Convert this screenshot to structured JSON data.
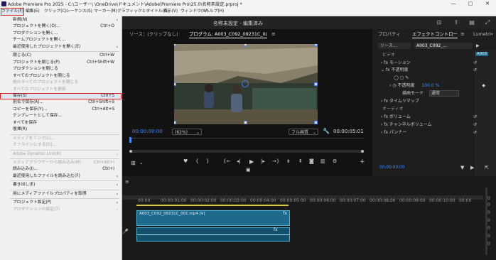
{
  "window": {
    "title": "Adobe Premiere Pro 2025 - C:\\ユーザー\\        \\OneDrive\\ドキュメント\\Adobe\\Premiere Pro\\25.0\\名称未設定.prproj *",
    "minimize": "—",
    "maximize": "▢",
    "close": "✕"
  },
  "menubar": [
    "ファイル(F)",
    "編集(E)",
    "クリップ(C)",
    "シーケンス(S)",
    "マーカー(M)",
    "グラフィックとタイトル(G)",
    "表示(V)",
    "ウィンドウ(W)",
    "ヘルプ(H)"
  ],
  "project_title": "名称未設定 - 編集済み",
  "file_menu": [
    {
      "label": "新規(N)",
      "shortcut": "",
      "submenu": true,
      "disabled": false
    },
    {
      "label": "プロジェクトを開く(O)...",
      "shortcut": "Ctrl+O",
      "submenu": false,
      "disabled": false
    },
    {
      "label": "プロダクションを開く...",
      "shortcut": "",
      "submenu": false,
      "disabled": false
    },
    {
      "label": "チームプロジェクトを開く...",
      "shortcut": "",
      "submenu": false,
      "disabled": false
    },
    {
      "label": "最近使用したプロジェクトを開く(E)",
      "shortcut": "",
      "submenu": true,
      "disabled": false
    },
    {
      "sep": true
    },
    {
      "label": "閉じる(C)",
      "shortcut": "Ctrl+W",
      "submenu": false,
      "disabled": false
    },
    {
      "label": "プロジェクトを閉じる(P)",
      "shortcut": "Ctrl+Shift+W",
      "submenu": false,
      "disabled": false
    },
    {
      "label": "プロダクションを閉じる",
      "shortcut": "",
      "submenu": false,
      "disabled": false
    },
    {
      "label": "すべてのプロジェクトを閉じる",
      "shortcut": "",
      "submenu": false,
      "disabled": false
    },
    {
      "label": "他のすべてのプロジェクトを閉じる",
      "shortcut": "",
      "submenu": false,
      "disabled": true
    },
    {
      "label": "すべてのプロジェクトを更新",
      "shortcut": "",
      "submenu": false,
      "disabled": true
    },
    {
      "label": "保存(S)",
      "shortcut": "Ctrl+S",
      "submenu": false,
      "disabled": false,
      "highlight": true
    },
    {
      "label": "別名で保存(A)...",
      "shortcut": "Ctrl+Shift+S",
      "submenu": false,
      "disabled": false
    },
    {
      "label": "コピーを保存(Y)...",
      "shortcut": "Ctrl+Alt+S",
      "submenu": false,
      "disabled": false
    },
    {
      "label": "テンプレートとして保存...",
      "shortcut": "",
      "submenu": false,
      "disabled": false
    },
    {
      "label": "すべてを保存",
      "shortcut": "",
      "submenu": false,
      "disabled": false
    },
    {
      "label": "復帰(R)",
      "shortcut": "",
      "submenu": false,
      "disabled": false
    },
    {
      "sep": true
    },
    {
      "label": "メディアをリンク(L)...",
      "shortcut": "",
      "submenu": false,
      "disabled": true
    },
    {
      "label": "オフラインにする(O)...",
      "shortcut": "",
      "submenu": false,
      "disabled": true
    },
    {
      "sep": true
    },
    {
      "label": "Adobe Dynamic Link(K)",
      "shortcut": "",
      "submenu": true,
      "disabled": true
    },
    {
      "sep": true
    },
    {
      "label": "メディアブラウザーから読み込み(M)",
      "shortcut": "Ctrl+Alt+I",
      "submenu": false,
      "disabled": true
    },
    {
      "label": "読み込み(I)...",
      "shortcut": "Ctrl+I",
      "submenu": false,
      "disabled": false
    },
    {
      "label": "最近使用したファイルを読み込む(F)",
      "shortcut": "",
      "submenu": true,
      "disabled": false
    },
    {
      "sep": true
    },
    {
      "label": "書き出し(E)",
      "shortcut": "",
      "submenu": true,
      "disabled": false
    },
    {
      "sep": true
    },
    {
      "label": "用にメディアファイルプロパティを取得",
      "shortcut": "",
      "submenu": true,
      "disabled": false
    },
    {
      "sep": true
    },
    {
      "label": "プロジェクト設定(P)",
      "shortcut": "",
      "submenu": true,
      "disabled": false
    },
    {
      "label": "プロダクションの設定(T)",
      "shortcut": "",
      "submenu": true,
      "disabled": true
    }
  ],
  "monitor": {
    "source_tab": "ソース：(クリップなし)",
    "program_tab": "プログラム: A003_C092_09231C_0(",
    "timecode": "00:00:00:00",
    "zoom": "(62%)",
    "quality": "フル画質",
    "duration": "00:00:05:01"
  },
  "effects": {
    "tabs": [
      "プロパティ",
      "エフェクトコントロー",
      "Lumetri"
    ],
    "master": "ソース...",
    "clip": "A003_C092_...",
    "video_section": "ビデオ",
    "motion": "モーション",
    "opacity": "不透明度",
    "opacity_label": "不透明度",
    "opacity_value": "100.0 %",
    "blend_label": "描画モード",
    "blend_value": "通常",
    "time_remap": "タイムリマップ",
    "audio_section": "オーディオ",
    "volume": "ボリューム",
    "channel_volume": "チャンネルボリューム",
    "panner": "パンナー",
    "timecode": "00:00:00:00",
    "clip_badge": "A003"
  },
  "timeline": {
    "ruler": [
      "00:00",
      "00:00:01:00",
      "00:00:02:00",
      "00:00:03:00",
      "00:00:04:00",
      "00:00:05:00",
      "00:00:06:00",
      "00:00:07:00",
      "00:00:08:00",
      "00:00:09:00",
      "00:00:10:00",
      "00:00"
    ],
    "video_clip": "A003_C092_09231C_001.mp4 [V]",
    "volume_labels": [
      "0",
      "0",
      "0",
      "0",
      "0",
      "0",
      "0"
    ]
  }
}
